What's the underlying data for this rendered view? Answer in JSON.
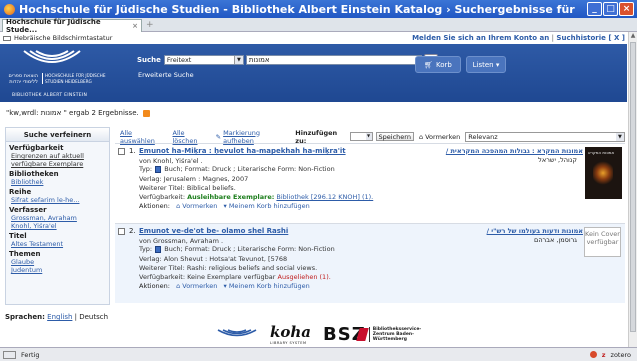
{
  "window": {
    "title": "Hochschule für Jüdische Studien - Bibliothek Albert Einstein Katalog › Suchergebnisse für 'kw,wrdl: אמונות' - Mozilla Firefox",
    "tab_label": "Hochschule für Jüdische Stude...",
    "tab_close": "×",
    "new_tab": "+"
  },
  "topbar": {
    "keyboard_label": "Hebräische Bildschirmtastatur",
    "login_text": "Melden Sie sich an Ihrem Konto an",
    "sep": "|",
    "search_history": "Suchhistorie [ X ]"
  },
  "logo": {
    "hebrew_lines": "הוצאת ספרים ללימודי יהדות",
    "german_lines": "HOCHSCHULE FÜR JÜDISCHE STUDIEN HEIDELBERG",
    "library": "BIBLIOTHEK ALBERT EINSTEIN"
  },
  "search": {
    "label": "Suche",
    "type_value": "Freitext",
    "query_value": "אמונות",
    "ok_label": "OK",
    "korb_label": "Korb",
    "listen_label": "Listen ▾",
    "advanced_link": "Erweiterte Suche"
  },
  "results": {
    "summary": "\"kw,wrdl: אמונות \" ergab 2 Ergebnisse."
  },
  "sidebar": {
    "heading": "Suche verfeinern",
    "facets": [
      {
        "title": "Verfügbarkeit",
        "items": [
          {
            "label": "Eingrenzen auf aktuell verfügbare Exemplare",
            "link": true
          }
        ]
      },
      {
        "title": "Bibliotheken",
        "items": [
          {
            "label": "Bibliothek",
            "link": true
          }
        ]
      },
      {
        "title": "Reihe",
        "items": [
          {
            "label": "Sifrat sefarim le-he...",
            "link": true
          }
        ]
      },
      {
        "title": "Verfasser",
        "items": [
          {
            "label": "Grossman, Avraham",
            "link": true
          },
          {
            "label": "Knohl, Yiśra'el",
            "link": true
          }
        ]
      },
      {
        "title": "Titel",
        "items": [
          {
            "label": "Altes Testament",
            "link": true
          }
        ]
      },
      {
        "title": "Themen",
        "items": [
          {
            "label": "Glaube",
            "link": true
          },
          {
            "label": "Judentum",
            "link": true
          }
        ]
      }
    ]
  },
  "toolbar": {
    "select_all": "Alle auswählen",
    "clear_all": "Alle löschen",
    "unmark": "Markierung aufheben",
    "add_to": "Hinzufügen zu:",
    "save": "Speichern",
    "reserve": "Vormerken",
    "sort_value": "Relevanz"
  },
  "records": [
    {
      "num": "1.",
      "title": "Emunot ha-Miḳra : ḥevulot ha-mapekhah ha-miḳra'it",
      "hebrew_title": "אמונות המקרא : גבולות המהפכה המקראית /",
      "hebrew_author": "קנוהל, ישראל",
      "author": "von Knohl, Yiśra'el .",
      "type": "Typ:",
      "type_rest": "Buch; Format: Druck ; Literarische Form: Non-Fiction",
      "publisher": "Verlag: Jerusalem : Magnes, 2007",
      "other_title": "Weiterer Titel: Biblical beliefs.",
      "avail_label": "Verfügbarkeit:",
      "avail_value": "Ausleihbare Exemplare:",
      "avail_rest": "Bibliothek [296.12 KNOH] (1).",
      "actions": "Aktionen:",
      "action_reserve": "Vormerken",
      "action_cart": "Meinem Korb hinzufügen",
      "cover_text": "אמונות המקרא"
    },
    {
      "num": "2.",
      "title": "Emunot ve-de'ot be- olamo shel Rashi",
      "hebrew_title": "אמונות ודעות בעולמו של רש\"י /",
      "hebrew_author": "גרוסמן, אברהם",
      "author": "von Grossman, Avraham .",
      "type": "Typ:",
      "type_rest": "Buch; Format: Druck ; Literarische Form: Non-Fiction",
      "publisher": "Verlag: Alon Shevut : Hotsa'at Tevunot, [5768",
      "other_title": "Weiterer Titel: Rashi: religious beliefs and social views.",
      "avail_label": "Verfügbarkeit:",
      "avail_value": "Keine Exemplare verfügbar",
      "avail_rest": "Ausgeliehen (1).",
      "actions": "Aktionen:",
      "action_reserve": "Vormerken",
      "action_cart": "Meinem Korb hinzufügen",
      "no_cover": "Kein Cover verfügbar"
    }
  ],
  "footer": {
    "lang_label": "Sprachen:",
    "lang_english": "English",
    "lang_deutsch": "| Deutsch",
    "koha": "koha",
    "koha_sub": "LIBRARY SYSTEM",
    "bsz": "BSZ",
    "bsz_text": "Bibliotheksservice-Zentrum Baden-Württemberg"
  },
  "statusbar": {
    "text": "Fertig",
    "zotero": "zotero"
  }
}
